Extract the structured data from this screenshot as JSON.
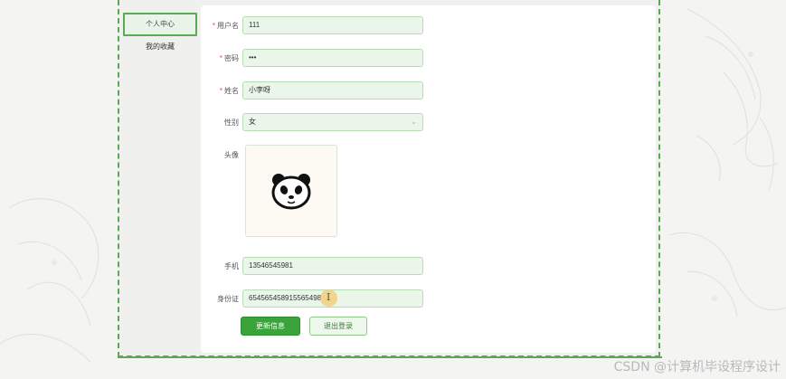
{
  "sidebar": {
    "items": [
      {
        "label": "个人中心",
        "active": true
      },
      {
        "label": "我的收藏",
        "active": false
      }
    ]
  },
  "form": {
    "username": {
      "label": "用户名",
      "required": true,
      "value": "111"
    },
    "password": {
      "label": "密码",
      "required": true,
      "value": "•••"
    },
    "name": {
      "label": "姓名",
      "required": true,
      "value": "小李呀"
    },
    "gender": {
      "label": "性别",
      "value": "女",
      "chevron": "⌄"
    },
    "avatar": {
      "label": "头像"
    },
    "phone": {
      "label": "手机",
      "value": "13546545981"
    },
    "id_card": {
      "label": "身份证",
      "value": "654565458915565498"
    }
  },
  "buttons": {
    "update": "更新信息",
    "logout": "退出登录"
  },
  "required_mark": "*",
  "cursor_glyph": "I",
  "watermark": "CSDN @计算机毕设程序设计",
  "colors": {
    "accent": "#3aa43a",
    "border": "#5aaa55",
    "field_bg": "#eaf6e9"
  }
}
